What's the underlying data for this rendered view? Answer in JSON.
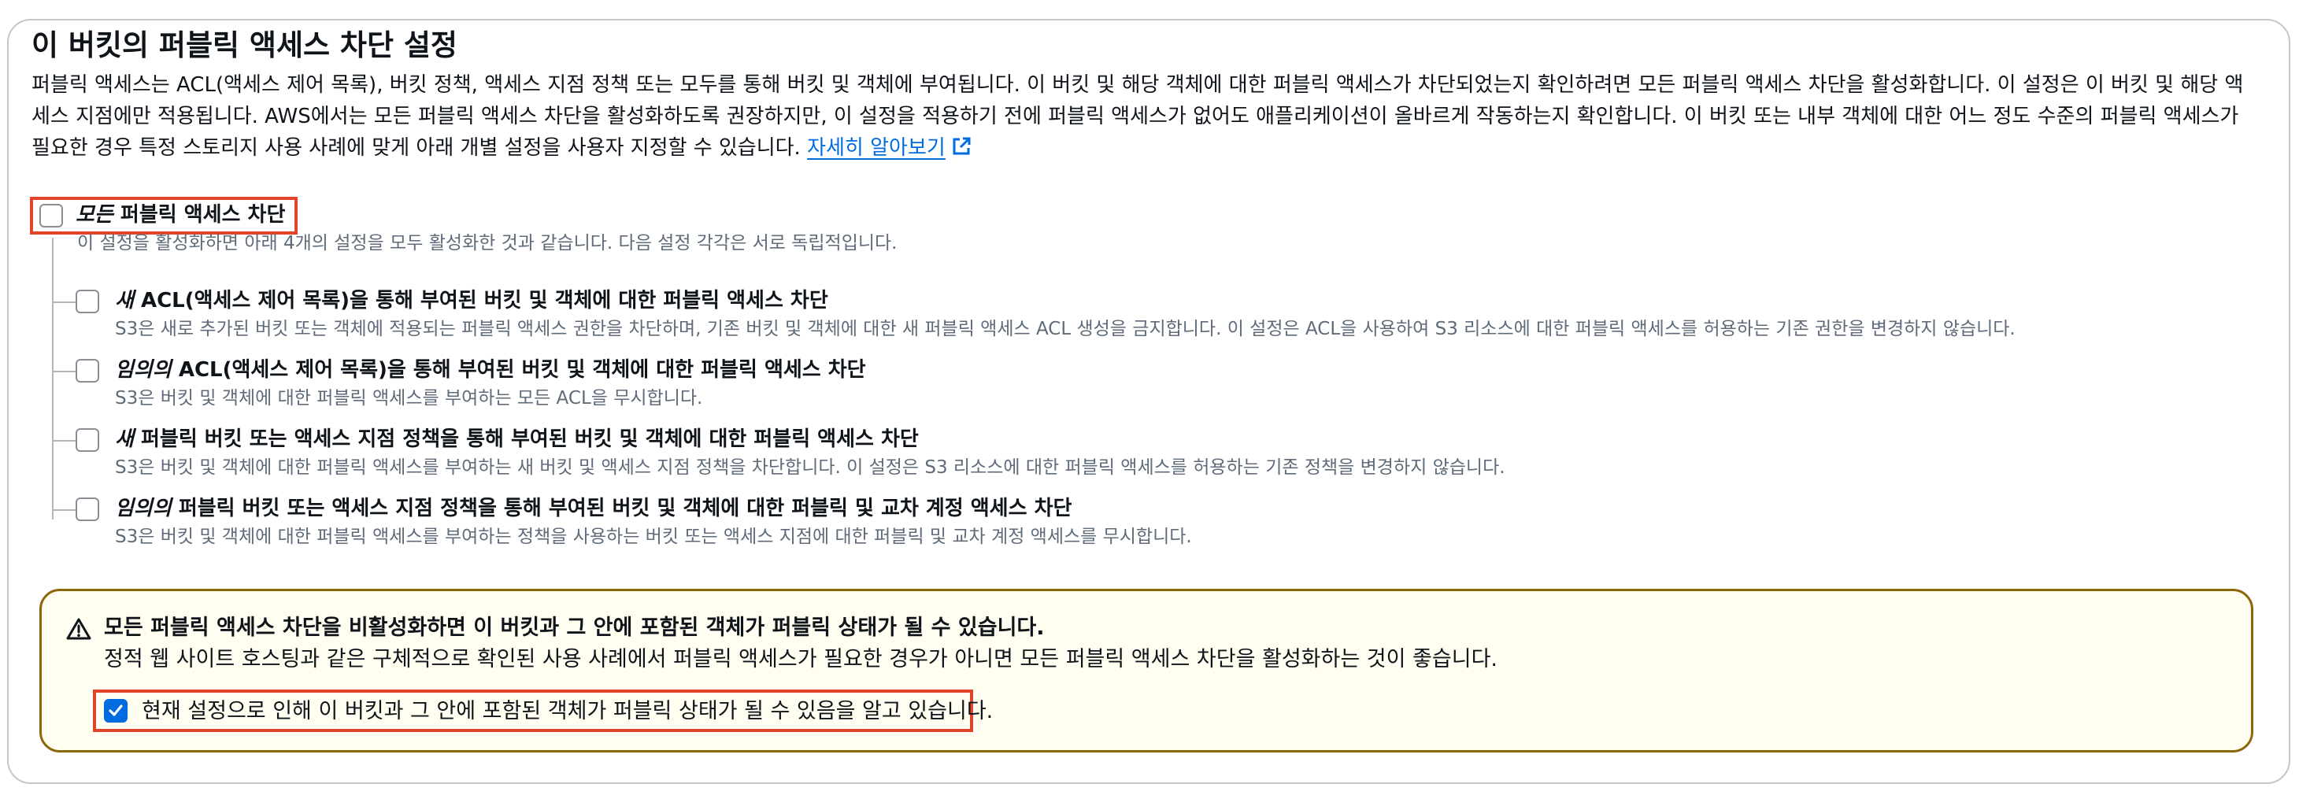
{
  "section": {
    "title": "이 버킷의 퍼블릭 액세스 차단 설정",
    "description_lines": [
      "퍼블릭 액세스는 ACL(액세스 제어 목록), 버킷 정책, 액세스 지점 정책 또는 모두를 통해 버킷 및 객체에 부여됩니다. 이 버킷 및 해당 객체에 대한 퍼블릭 액세스가 차단되었는지 확인하려면 모든 퍼블릭 액세스 차단을 활성화합니다. 이 설정은 이 버킷 및 해당 액",
      "세스 지점에만 적용됩니다. AWS에서는 모든 퍼블릭 액세스 차단을 활성화하도록 권장하지만, 이 설정을 적용하기 전에 퍼블릭 액세스가 없어도 애플리케이션이 올바르게 작동하는지 확인합니다. 이 버킷 또는 내부 객체에 대한 어느 정도 수준의 퍼블릭 액세스가",
      "필요한 경우 특정 스토리지 사용 사례에 맞게 아래 개별 설정을 사용자 지정할 수 있습니다."
    ],
    "learn_more": "자세히 알아보기",
    "learn_more_icon": "external-link-icon"
  },
  "block_all": {
    "label_emphasis": "모든",
    "label_rest": " 퍼블릭 액세스 차단",
    "description": "이 설정을 활성화하면 아래 4개의 설정을 모두 활성화한 것과 같습니다. 다음 설정 각각은 서로 독립적입니다.",
    "checked": false
  },
  "options": [
    {
      "label_emphasis": "새",
      "label_rest": " ACL(액세스 제어 목록)을 통해 부여된 버킷 및 객체에 대한 퍼블릭 액세스 차단",
      "description": "S3은 새로 추가된 버킷 또는 객체에 적용되는 퍼블릭 액세스 권한을 차단하며, 기존 버킷 및 객체에 대한 새 퍼블릭 액세스 ACL 생성을 금지합니다. 이 설정은 ACL을 사용하여 S3 리소스에 대한 퍼블릭 액세스를 허용하는 기존 권한을 변경하지 않습니다.",
      "checked": false
    },
    {
      "label_emphasis": "임의의",
      "label_rest": " ACL(액세스 제어 목록)을 통해 부여된 버킷 및 객체에 대한 퍼블릭 액세스 차단",
      "description": "S3은 버킷 및 객체에 대한 퍼블릭 액세스를 부여하는 모든 ACL을 무시합니다.",
      "checked": false
    },
    {
      "label_emphasis": "새",
      "label_rest": " 퍼블릭 버킷 또는 액세스 지점 정책을 통해 부여된 버킷 및 객체에 대한 퍼블릭 액세스 차단",
      "description": "S3은 버킷 및 객체에 대한 퍼블릭 액세스를 부여하는 새 버킷 및 액세스 지점 정책을 차단합니다. 이 설정은 S3 리소스에 대한 퍼블릭 액세스를 허용하는 기존 정책을 변경하지 않습니다.",
      "checked": false
    },
    {
      "label_emphasis": "임의의",
      "label_rest": " 퍼블릭 버킷 또는 액세스 지점 정책을 통해 부여된 버킷 및 객체에 대한 퍼블릭 및 교차 계정 액세스 차단",
      "description": "S3은 버킷 및 객체에 대한 퍼블릭 액세스를 부여하는 정책을 사용하는 버킷 또는 액세스 지점에 대한 퍼블릭 및 교차 계정 액세스를 무시합니다.",
      "checked": false
    }
  ],
  "warning": {
    "icon": "warning-triangle-icon",
    "title": "모든 퍼블릭 액세스 차단을 비활성화하면 이 버킷과 그 안에 포함된 객체가 퍼블릭 상태가 될 수 있습니다.",
    "body": "정적 웹 사이트 호스팅과 같은 구체적으로 확인된 사용 사례에서 퍼블릭 액세스가 필요한 경우가 아니면 모든 퍼블릭 액세스 차단을 활성화하는 것이 좋습니다.",
    "acknowledge_label": "현재 설정으로 인해 이 버킷과 그 안에 포함된 객체가 퍼블릭 상태가 될 수 있음을 알고 있습니다.",
    "acknowledge_checked": true
  },
  "colors": {
    "link": "#006ce0",
    "highlight": "#e1442b",
    "warning_border": "#8d6605",
    "warning_bg": "#fffef0",
    "checkbox_checked": "#006ce0"
  }
}
